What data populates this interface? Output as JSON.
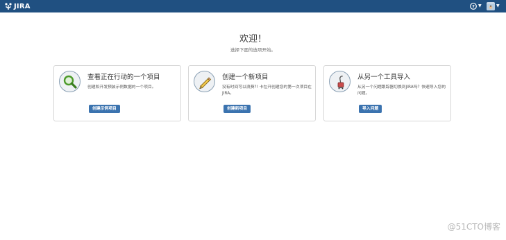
{
  "header": {
    "logo_text": "JIRA",
    "logo_icon": "jira-logo-icon",
    "help_icon": "help-icon",
    "user_icon": "user-avatar",
    "bar_color": "#205081"
  },
  "welcome": {
    "title": "欢迎！",
    "subtitle": "选择下面的选项开始。"
  },
  "cards": [
    {
      "icon": "magnifier-icon",
      "title": "查看正在行动的一个项目",
      "description": "创建和开发预装示例数据的一个项目。",
      "button": "创建示例项目"
    },
    {
      "icon": "pencil-icon",
      "title": "创建一个新项目",
      "description": "没有时间可以浪费?! 卡在开创建您的第一次项目在 JIRA。",
      "button": "创建新项目"
    },
    {
      "icon": "vacuum-icon",
      "title": "从另一个工具导入",
      "description": "从另一个问题跟踪器切换到JIRA吗？快速导入您的问题。",
      "button": "导入问题"
    }
  ],
  "watermark": "@51CTO博客",
  "colors": {
    "button": "#3b73af",
    "accent": "#205081"
  }
}
